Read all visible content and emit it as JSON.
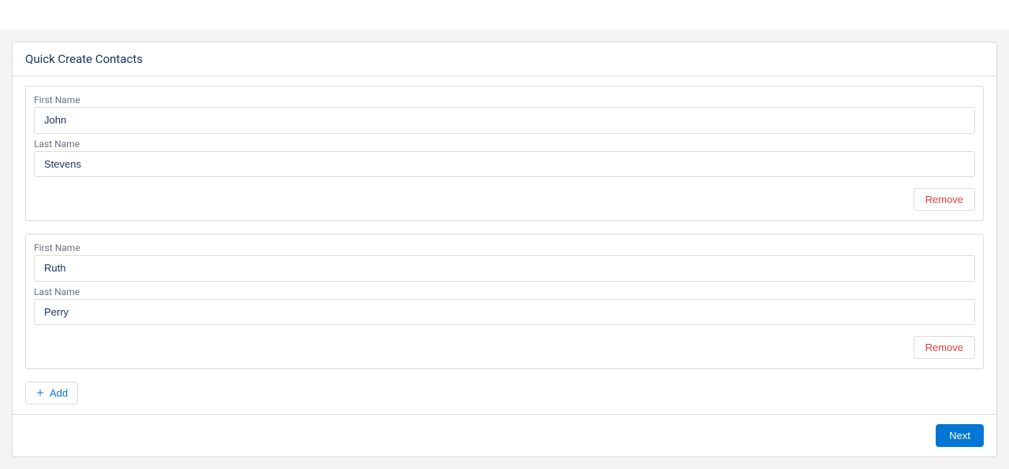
{
  "header": {
    "title": "Quick Create Contacts"
  },
  "labels": {
    "first_name": "First Name",
    "last_name": "Last Name"
  },
  "contacts": [
    {
      "first_name": "John",
      "last_name": "Stevens"
    },
    {
      "first_name": "Ruth",
      "last_name": "Perry"
    }
  ],
  "buttons": {
    "remove": "Remove",
    "add": "Add",
    "next": "Next"
  }
}
